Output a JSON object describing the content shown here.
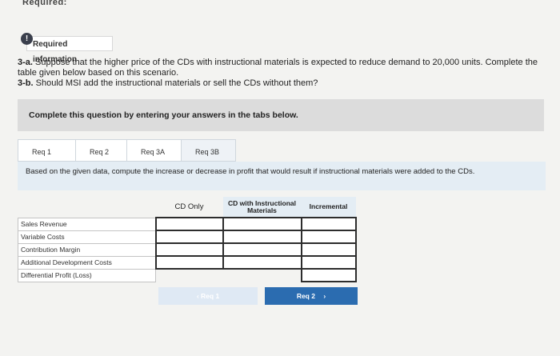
{
  "header": {
    "cut_title": "Required:"
  },
  "info": {
    "label": "Required information"
  },
  "question": {
    "q3a_prefix": "3-a.",
    "q3a_text": " Suppose that the higher price of the CDs with instructional materials is expected to reduce demand to 20,000 units. Complete the table given below based on this scenario.",
    "q3b_prefix": "3-b.",
    "q3b_text": " Should MSI add the instructional materials or sell the CDs without them?"
  },
  "instruction": "Complete this question by entering your answers in the tabs below.",
  "tabs": [
    "Req 1",
    "Req 2",
    "Req 3A",
    "Req 3B"
  ],
  "panel_text": "Based on the given data, compute the increase or decrease in profit that would result if instructional materials were added to the CDs.",
  "table": {
    "columns": [
      "CD Only",
      "CD with Instructional Materials",
      "Incremental"
    ],
    "rows": [
      "Sales Revenue",
      "Variable Costs",
      "Contribution Margin",
      "Additional Development Costs",
      "Differential Profit (Loss)"
    ]
  },
  "nav": {
    "prev_label": "Req 1",
    "next_label": "Req 2",
    "prev_icon": "chevron-left",
    "next_icon": "chevron-right"
  }
}
